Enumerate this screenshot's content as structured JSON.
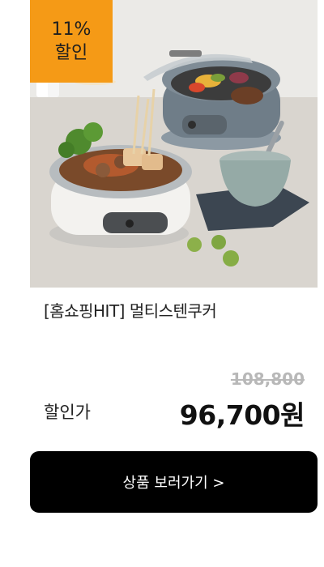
{
  "badge": {
    "line1": "11%",
    "line2": "할인"
  },
  "product": {
    "title": "[홈쇼핑HIT] 멀티스텐쿠커",
    "original_price": "108,800",
    "sale_label": "할인가",
    "sale_price": "96,700원"
  },
  "cta": {
    "label": "상품 보러가기 >"
  },
  "colors": {
    "badge": "#f59a16",
    "cta_bg": "#000000",
    "strike": "#b8b8b8"
  }
}
